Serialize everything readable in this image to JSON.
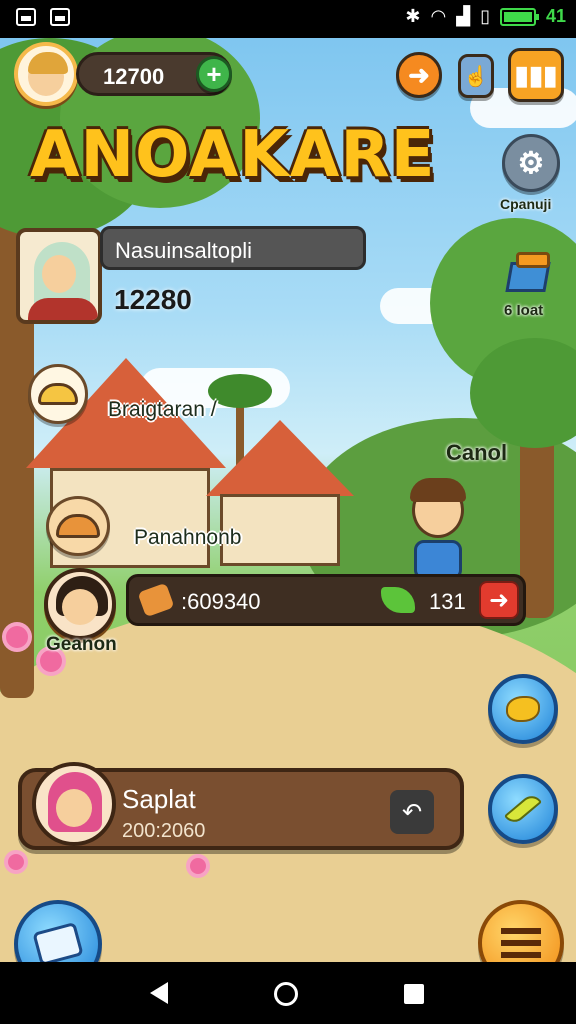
{
  "status_bar": {
    "time": "41"
  },
  "player": {
    "coins": "12700",
    "add_label": "+"
  },
  "game": {
    "title": "ANOAKARE"
  },
  "right_menu": {
    "settings_label": "Cpanuji",
    "shop_label": "6 Ioat",
    "character_label": "Canol"
  },
  "profile": {
    "name": "Nasuinsaltopli",
    "score": "12280"
  },
  "quests": [
    {
      "label": "Braigtaran /"
    },
    {
      "label": "Panahnonb"
    }
  ],
  "friend": {
    "label": "Geanon"
  },
  "resources": {
    "food": ":609340",
    "gems": "131"
  },
  "message": {
    "name": "Saplat",
    "time": "200:2060"
  },
  "colors": {
    "accent_gold": "#ffc21c",
    "wood": "#7a4f30",
    "blue_button": "#1e82d8",
    "orange_button": "#f28a12"
  }
}
